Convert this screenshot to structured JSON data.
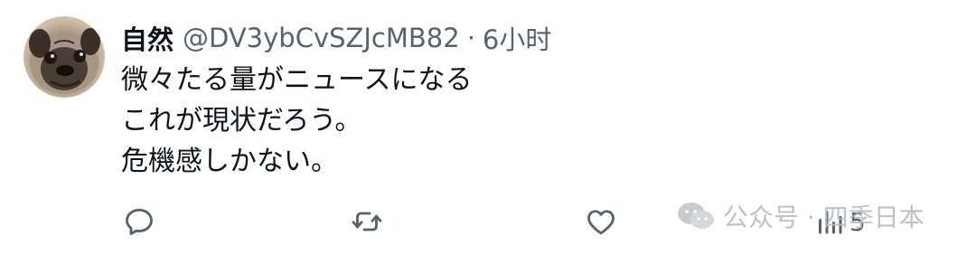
{
  "tweet": {
    "author_name": "自然",
    "handle": "@DV3ybCvSZJcMB82",
    "separator": "·",
    "time": "6小时",
    "lines": [
      "微々たる量がニュースになる",
      "これが現状だろう。",
      "危機感しかない。"
    ],
    "actions": {
      "reply_icon": "reply-icon",
      "retweet_icon": "retweet-icon",
      "like_icon": "heart-icon",
      "views_icon": "views-icon",
      "views_count": "5"
    }
  },
  "watermark": {
    "text": "公众号 · 四季日本",
    "icon": "wechat-icon"
  },
  "colors": {
    "text": "#0f1419",
    "secondary": "#536471",
    "watermark": "#b7bbbf"
  }
}
